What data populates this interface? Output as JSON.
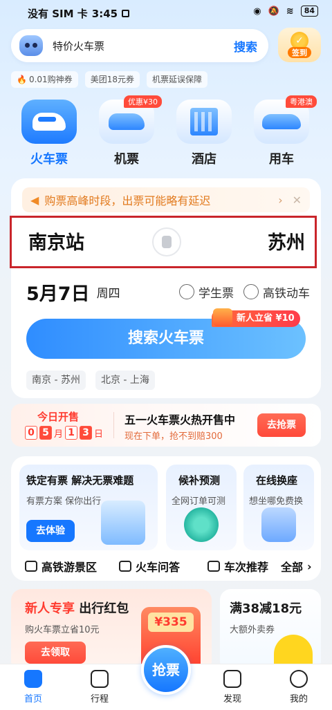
{
  "status_bar": {
    "carrier": "没有 SIM 卡",
    "time": "3:45",
    "battery": "84"
  },
  "search": {
    "placeholder": "特价火车票",
    "button": "搜索"
  },
  "checkin": {
    "label": "签到"
  },
  "chips": [
    "0.01购神券",
    "美团18元券",
    "机票延误保障"
  ],
  "categories": [
    {
      "label": "火车票",
      "selected": true,
      "tag": ""
    },
    {
      "label": "机票",
      "selected": false,
      "tag": "优惠¥30"
    },
    {
      "label": "酒店",
      "selected": false,
      "tag": ""
    },
    {
      "label": "用车",
      "selected": false,
      "tag": "粤港澳"
    }
  ],
  "notice": {
    "text": "购票高峰时段，出票可能略有延迟"
  },
  "route": {
    "from": "南京站",
    "to": "苏州"
  },
  "date": {
    "date": "5月7日",
    "weekday": "周四"
  },
  "options": [
    "学生票",
    "高铁动车"
  ],
  "search_button": "搜索火车票",
  "new_user_badge": "新人立省 ¥10",
  "history": [
    "南京 - 苏州",
    "北京 - 上海"
  ],
  "promo": {
    "title": "今日开售",
    "digits": [
      "0",
      "5",
      "1",
      "3"
    ],
    "month_unit": "月",
    "day_unit": "日",
    "headline": "五一火车票火热开售中",
    "subline": "现在下单，抢不到赔300",
    "button": "去抢票"
  },
  "features": [
    {
      "title": "铁定有票 解决无票难题",
      "subtitle": "有票方案 保你出行",
      "button": "去体验"
    },
    {
      "title": "候补预测",
      "subtitle": "全网订单可测"
    },
    {
      "title": "在线换座",
      "subtitle": "想坐哪免费换"
    }
  ],
  "links": [
    "高铁游景区",
    "火车问答",
    "车次推荐",
    "全部"
  ],
  "bottom_cards": {
    "left": {
      "title_red": "新人专享",
      "title": "出行红包",
      "subtitle": "购火车票立省10元",
      "button": "去领取",
      "amount": "¥335",
      "envelope_label": "出行红包"
    },
    "right": {
      "title": "满38减18元",
      "subtitle": "大额外卖券"
    }
  },
  "tabs": [
    {
      "label": "首页",
      "selected": true
    },
    {
      "label": "行程",
      "selected": false
    },
    {
      "label": "发现",
      "selected": false
    },
    {
      "label": "我的",
      "selected": false
    }
  ],
  "grab_button": "抢票",
  "colors": {
    "accent": "#1677ff",
    "alert": "#ff3b2f",
    "notice": "#e27a1e"
  }
}
